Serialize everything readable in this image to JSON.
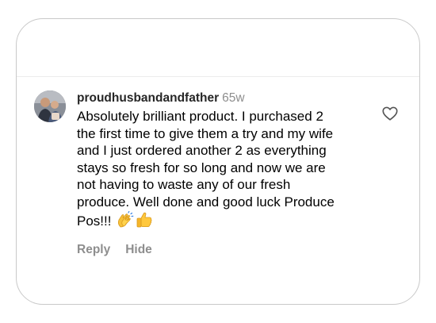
{
  "comment": {
    "username": "proudhusbandandfather",
    "timestamp": "65w",
    "text_lines": [
      "Absolutely brilliant product. I purchased 2",
      "the first time to give them a try and my wife",
      "and I just ordered another 2 as everything",
      "stays so fresh for so long and now we are",
      "not having to waste any of our fresh",
      "produce. Well done and good luck Produce",
      "Pos!!!"
    ],
    "emoji_icons": [
      "clapping-hands-icon",
      "thumbs-up-icon"
    ],
    "actions": {
      "reply_label": "Reply",
      "hide_label": "Hide"
    },
    "like_icon": "heart-outline-icon"
  },
  "colors": {
    "username": "#262626",
    "timestamp": "#8e8e8e",
    "body": "#000000",
    "actions": "#8e8e8e",
    "card_border": "#c9c9c9",
    "emoji_yellow": "#f7c23a"
  }
}
